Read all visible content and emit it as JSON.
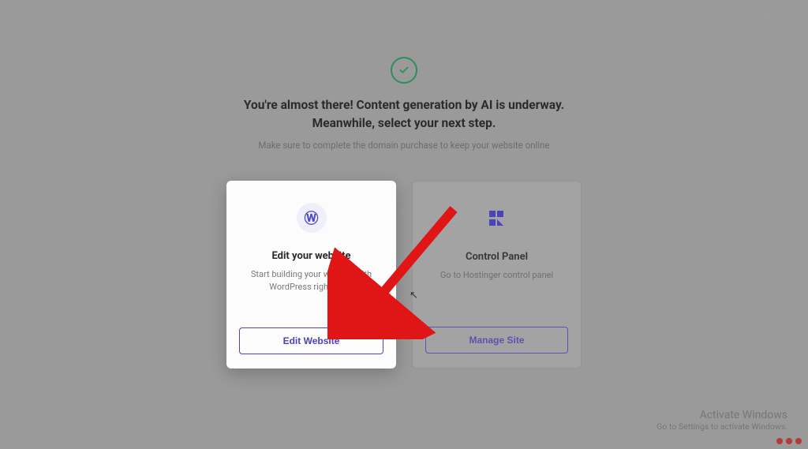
{
  "colors": {
    "accent": "#4b44b8",
    "success": "#2a8f5d",
    "annotation": "#e01616"
  },
  "header": {
    "headline": "You're almost there! Content generation by AI is underway. Meanwhile, select your next step.",
    "subtext": "Make sure to complete the domain purchase to keep your website online"
  },
  "cards": {
    "edit": {
      "icon": "wordpress-icon",
      "title": "Edit your website",
      "description": "Start building your website with WordPress right away",
      "button": "Edit Website"
    },
    "panel": {
      "icon": "control-panel-icon",
      "title": "Control Panel",
      "description": "Go to Hostinger control panel",
      "button": "Manage Site"
    }
  },
  "watermark": {
    "line1": "Activate Windows",
    "line2": "Go to Settings to activate Windows."
  }
}
